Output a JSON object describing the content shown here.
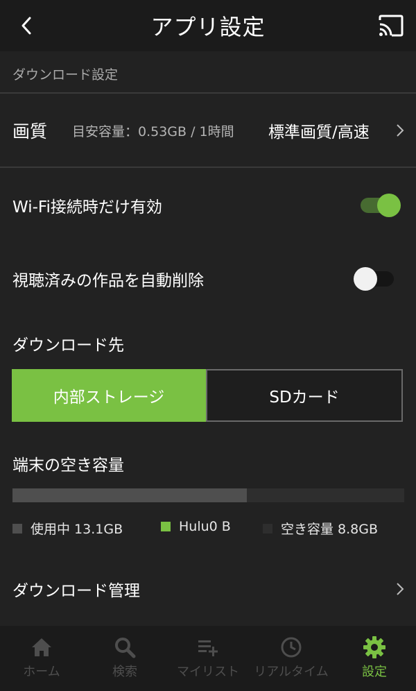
{
  "header": {
    "title": "アプリ設定",
    "back_icon": "chevron-left-icon",
    "cast_icon": "cast-icon"
  },
  "download_settings": {
    "section_title": "ダウンロード設定",
    "quality": {
      "label": "画質",
      "estimate": "目安容量：0.53GB / 1時間",
      "value": "標準画質/高速"
    },
    "wifi_only": {
      "label": "Wi-Fi接続時だけ有効",
      "enabled": true
    },
    "auto_delete": {
      "label": "視聴済みの作品を自動削除",
      "enabled": false
    },
    "destination": {
      "label": "ダウンロード先",
      "options": [
        "内部ストレージ",
        "SDカード"
      ],
      "selected": "内部ストレージ"
    },
    "storage": {
      "label": "端末の空き容量",
      "used_fraction": 0.598,
      "hulu_fraction": 0.0,
      "legend": [
        {
          "text": "使用中 13.1GB",
          "color": "#4f4f4f"
        },
        {
          "text": "Hulu0 B",
          "color": "#7ac143"
        },
        {
          "text": "空き容量 8.8GB",
          "color": "#2e2e2e"
        }
      ]
    },
    "management": {
      "label": "ダウンロード管理"
    }
  },
  "bottom_nav": {
    "tabs": [
      {
        "label": "ホーム",
        "icon": "home-icon",
        "active": false
      },
      {
        "label": "検索",
        "icon": "search-icon",
        "active": false
      },
      {
        "label": "マイリスト",
        "icon": "playlist-add-icon",
        "active": false
      },
      {
        "label": "リアルタイム",
        "icon": "clock-icon",
        "active": false
      },
      {
        "label": "設定",
        "icon": "gear-icon",
        "active": true
      }
    ]
  },
  "colors": {
    "accent": "#7ac143",
    "background": "#222222",
    "header": "#1b1b1b"
  }
}
